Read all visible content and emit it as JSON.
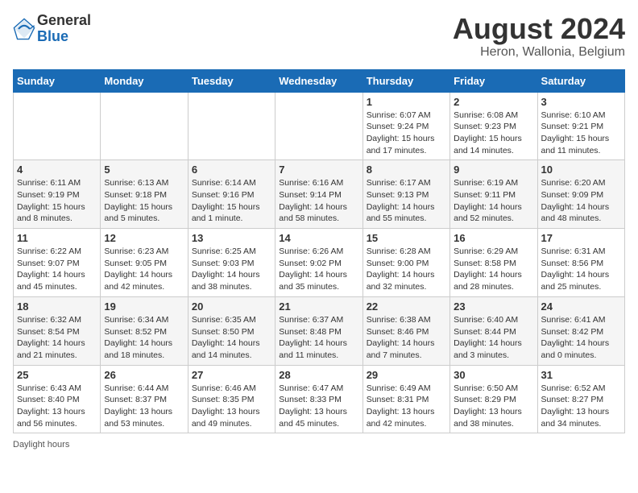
{
  "header": {
    "logo_line1": "General",
    "logo_line2": "Blue",
    "title": "August 2024",
    "subtitle": "Heron, Wallonia, Belgium"
  },
  "weekdays": [
    "Sunday",
    "Monday",
    "Tuesday",
    "Wednesday",
    "Thursday",
    "Friday",
    "Saturday"
  ],
  "weeks": [
    [
      {
        "day": "",
        "info": ""
      },
      {
        "day": "",
        "info": ""
      },
      {
        "day": "",
        "info": ""
      },
      {
        "day": "",
        "info": ""
      },
      {
        "day": "1",
        "info": "Sunrise: 6:07 AM\nSunset: 9:24 PM\nDaylight: 15 hours and 17 minutes."
      },
      {
        "day": "2",
        "info": "Sunrise: 6:08 AM\nSunset: 9:23 PM\nDaylight: 15 hours and 14 minutes."
      },
      {
        "day": "3",
        "info": "Sunrise: 6:10 AM\nSunset: 9:21 PM\nDaylight: 15 hours and 11 minutes."
      }
    ],
    [
      {
        "day": "4",
        "info": "Sunrise: 6:11 AM\nSunset: 9:19 PM\nDaylight: 15 hours and 8 minutes."
      },
      {
        "day": "5",
        "info": "Sunrise: 6:13 AM\nSunset: 9:18 PM\nDaylight: 15 hours and 5 minutes."
      },
      {
        "day": "6",
        "info": "Sunrise: 6:14 AM\nSunset: 9:16 PM\nDaylight: 15 hours and 1 minute."
      },
      {
        "day": "7",
        "info": "Sunrise: 6:16 AM\nSunset: 9:14 PM\nDaylight: 14 hours and 58 minutes."
      },
      {
        "day": "8",
        "info": "Sunrise: 6:17 AM\nSunset: 9:13 PM\nDaylight: 14 hours and 55 minutes."
      },
      {
        "day": "9",
        "info": "Sunrise: 6:19 AM\nSunset: 9:11 PM\nDaylight: 14 hours and 52 minutes."
      },
      {
        "day": "10",
        "info": "Sunrise: 6:20 AM\nSunset: 9:09 PM\nDaylight: 14 hours and 48 minutes."
      }
    ],
    [
      {
        "day": "11",
        "info": "Sunrise: 6:22 AM\nSunset: 9:07 PM\nDaylight: 14 hours and 45 minutes."
      },
      {
        "day": "12",
        "info": "Sunrise: 6:23 AM\nSunset: 9:05 PM\nDaylight: 14 hours and 42 minutes."
      },
      {
        "day": "13",
        "info": "Sunrise: 6:25 AM\nSunset: 9:03 PM\nDaylight: 14 hours and 38 minutes."
      },
      {
        "day": "14",
        "info": "Sunrise: 6:26 AM\nSunset: 9:02 PM\nDaylight: 14 hours and 35 minutes."
      },
      {
        "day": "15",
        "info": "Sunrise: 6:28 AM\nSunset: 9:00 PM\nDaylight: 14 hours and 32 minutes."
      },
      {
        "day": "16",
        "info": "Sunrise: 6:29 AM\nSunset: 8:58 PM\nDaylight: 14 hours and 28 minutes."
      },
      {
        "day": "17",
        "info": "Sunrise: 6:31 AM\nSunset: 8:56 PM\nDaylight: 14 hours and 25 minutes."
      }
    ],
    [
      {
        "day": "18",
        "info": "Sunrise: 6:32 AM\nSunset: 8:54 PM\nDaylight: 14 hours and 21 minutes."
      },
      {
        "day": "19",
        "info": "Sunrise: 6:34 AM\nSunset: 8:52 PM\nDaylight: 14 hours and 18 minutes."
      },
      {
        "day": "20",
        "info": "Sunrise: 6:35 AM\nSunset: 8:50 PM\nDaylight: 14 hours and 14 minutes."
      },
      {
        "day": "21",
        "info": "Sunrise: 6:37 AM\nSunset: 8:48 PM\nDaylight: 14 hours and 11 minutes."
      },
      {
        "day": "22",
        "info": "Sunrise: 6:38 AM\nSunset: 8:46 PM\nDaylight: 14 hours and 7 minutes."
      },
      {
        "day": "23",
        "info": "Sunrise: 6:40 AM\nSunset: 8:44 PM\nDaylight: 14 hours and 3 minutes."
      },
      {
        "day": "24",
        "info": "Sunrise: 6:41 AM\nSunset: 8:42 PM\nDaylight: 14 hours and 0 minutes."
      }
    ],
    [
      {
        "day": "25",
        "info": "Sunrise: 6:43 AM\nSunset: 8:40 PM\nDaylight: 13 hours and 56 minutes."
      },
      {
        "day": "26",
        "info": "Sunrise: 6:44 AM\nSunset: 8:37 PM\nDaylight: 13 hours and 53 minutes."
      },
      {
        "day": "27",
        "info": "Sunrise: 6:46 AM\nSunset: 8:35 PM\nDaylight: 13 hours and 49 minutes."
      },
      {
        "day": "28",
        "info": "Sunrise: 6:47 AM\nSunset: 8:33 PM\nDaylight: 13 hours and 45 minutes."
      },
      {
        "day": "29",
        "info": "Sunrise: 6:49 AM\nSunset: 8:31 PM\nDaylight: 13 hours and 42 minutes."
      },
      {
        "day": "30",
        "info": "Sunrise: 6:50 AM\nSunset: 8:29 PM\nDaylight: 13 hours and 38 minutes."
      },
      {
        "day": "31",
        "info": "Sunrise: 6:52 AM\nSunset: 8:27 PM\nDaylight: 13 hours and 34 minutes."
      }
    ]
  ],
  "footer": {
    "daylight_label": "Daylight hours"
  }
}
